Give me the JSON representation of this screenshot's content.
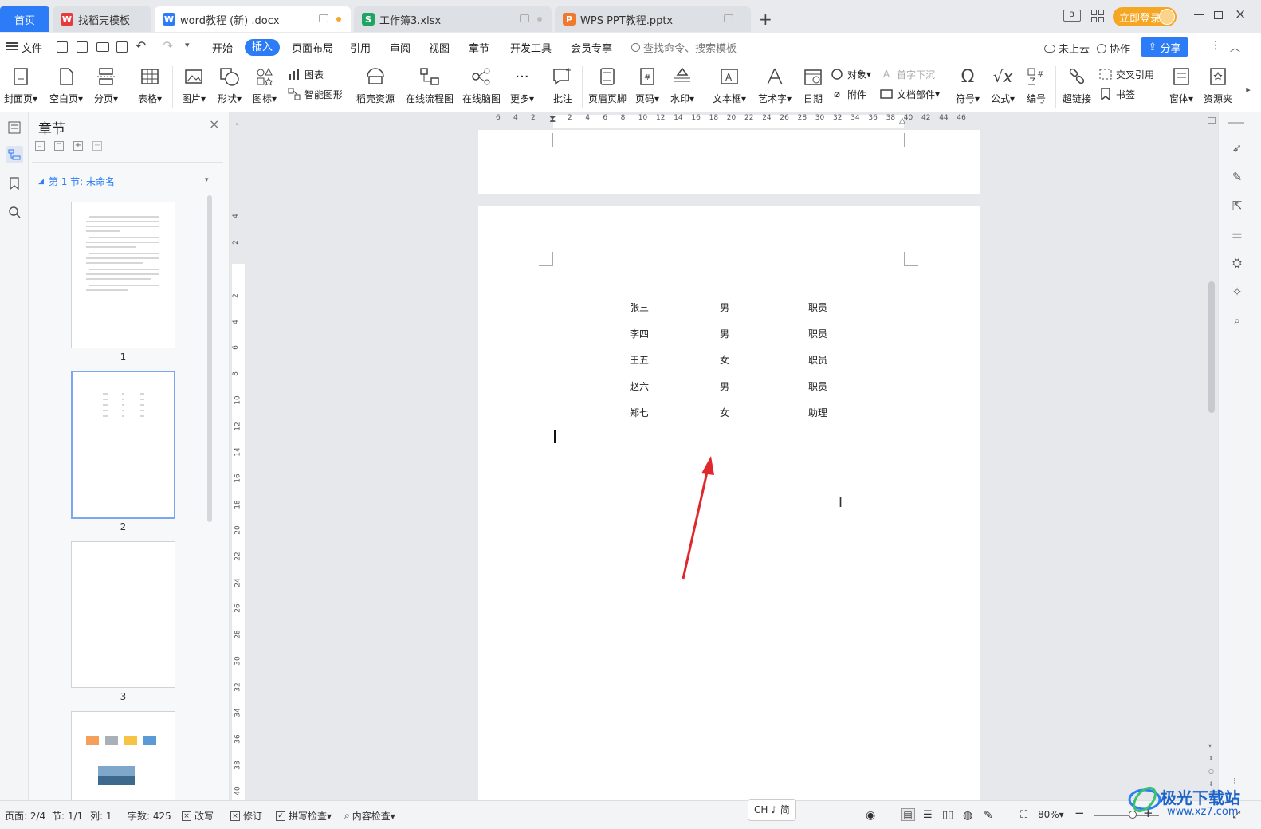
{
  "tabs": [
    {
      "label": "首页"
    },
    {
      "label": "找稻壳模板"
    },
    {
      "label": "word教程 (新) .docx"
    },
    {
      "label": "工作簿3.xlsx"
    },
    {
      "label": "WPS PPT教程.pptx"
    }
  ],
  "titlebar": {
    "login": "立即登录"
  },
  "menu": {
    "file": "文件",
    "items": [
      "开始",
      "插入",
      "页面布局",
      "引用",
      "审阅",
      "视图",
      "章节",
      "开发工具",
      "会员专享"
    ],
    "active": "插入",
    "search_placeholder": "查找命令、搜索模板",
    "cloud": "未上云",
    "collab": "协作",
    "share": "分享"
  },
  "ribbon": {
    "cover": "封面页",
    "blank": "空白页",
    "pagebreak": "分页",
    "table": "表格",
    "picture": "图片",
    "shape": "形状",
    "icon": "图标",
    "chart": "图表",
    "smartart": "智能图形",
    "docer": "稻壳资源",
    "flow": "在线流程图",
    "mind": "在线脑图",
    "more": "更多",
    "comment": "批注",
    "header": "页眉页脚",
    "pagenum": "页码",
    "watermark": "水印",
    "textbox": "文本框",
    "wordart": "艺术字",
    "date": "日期",
    "object": "对象",
    "attach": "附件",
    "dropcap": "首字下沉",
    "docparts": "文档部件",
    "symbol": "符号",
    "formula": "公式",
    "number": "编号",
    "hyperlink": "超链接",
    "crossref": "交叉引用",
    "bookmark": "书签",
    "window": "窗体",
    "resource": "资源夹"
  },
  "panel": {
    "title": "章节",
    "section": "第 1 节: 未命名",
    "pages": [
      "1",
      "2",
      "3"
    ]
  },
  "ruler": {
    "h": [
      "6",
      "4",
      "2",
      "2",
      "4",
      "6",
      "8",
      "10",
      "12",
      "14",
      "16",
      "18",
      "20",
      "22",
      "24",
      "26",
      "28",
      "30",
      "32",
      "34",
      "36",
      "38",
      "40",
      "42",
      "44",
      "46"
    ],
    "v": [
      "4",
      "2",
      "2",
      "4",
      "6",
      "8",
      "10",
      "12",
      "14",
      "16",
      "18",
      "20",
      "22",
      "24",
      "26",
      "28",
      "30",
      "32",
      "34",
      "36",
      "38",
      "40"
    ]
  },
  "document": {
    "rows": [
      [
        "张三",
        "男",
        "职员"
      ],
      [
        "李四",
        "男",
        "职员"
      ],
      [
        "王五",
        "女",
        "职员"
      ],
      [
        "赵六",
        "男",
        "职员"
      ],
      [
        "郑七",
        "女",
        "助理"
      ]
    ]
  },
  "status": {
    "page": "页面: 2/4",
    "section": "节: 1/1",
    "col": "列: 1",
    "words": "字数: 425",
    "overwrite": "改写",
    "revise": "修订",
    "spell": "拼写检查",
    "content": "内容检查",
    "ime": "CH ♪ 简",
    "zoom": "80%"
  },
  "watermark": {
    "brand": "极光下载站",
    "url": "www.xz7.com"
  },
  "colors": {
    "accent": "#2b7cf6",
    "arrow": "#e0282c",
    "login": "#f5a623"
  }
}
